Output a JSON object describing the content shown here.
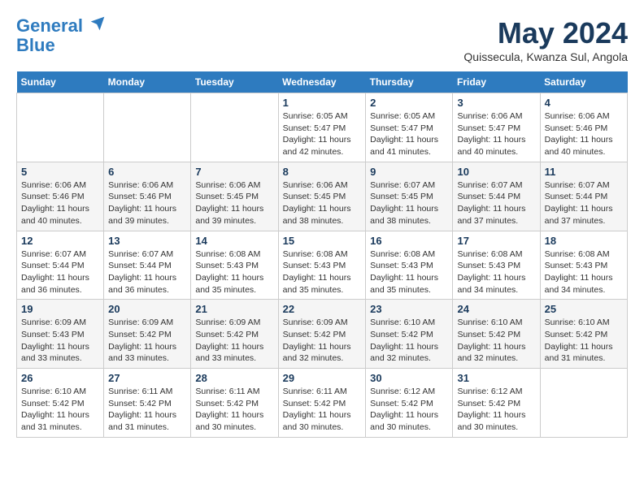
{
  "header": {
    "logo_line1": "General",
    "logo_line2": "Blue",
    "month_title": "May 2024",
    "location": "Quissecula, Kwanza Sul, Angola"
  },
  "weekdays": [
    "Sunday",
    "Monday",
    "Tuesday",
    "Wednesday",
    "Thursday",
    "Friday",
    "Saturday"
  ],
  "weeks": [
    [
      {
        "day": "",
        "info": ""
      },
      {
        "day": "",
        "info": ""
      },
      {
        "day": "",
        "info": ""
      },
      {
        "day": "1",
        "info": "Sunrise: 6:05 AM\nSunset: 5:47 PM\nDaylight: 11 hours and 42 minutes."
      },
      {
        "day": "2",
        "info": "Sunrise: 6:05 AM\nSunset: 5:47 PM\nDaylight: 11 hours and 41 minutes."
      },
      {
        "day": "3",
        "info": "Sunrise: 6:06 AM\nSunset: 5:47 PM\nDaylight: 11 hours and 40 minutes."
      },
      {
        "day": "4",
        "info": "Sunrise: 6:06 AM\nSunset: 5:46 PM\nDaylight: 11 hours and 40 minutes."
      }
    ],
    [
      {
        "day": "5",
        "info": "Sunrise: 6:06 AM\nSunset: 5:46 PM\nDaylight: 11 hours and 40 minutes."
      },
      {
        "day": "6",
        "info": "Sunrise: 6:06 AM\nSunset: 5:46 PM\nDaylight: 11 hours and 39 minutes."
      },
      {
        "day": "7",
        "info": "Sunrise: 6:06 AM\nSunset: 5:45 PM\nDaylight: 11 hours and 39 minutes."
      },
      {
        "day": "8",
        "info": "Sunrise: 6:06 AM\nSunset: 5:45 PM\nDaylight: 11 hours and 38 minutes."
      },
      {
        "day": "9",
        "info": "Sunrise: 6:07 AM\nSunset: 5:45 PM\nDaylight: 11 hours and 38 minutes."
      },
      {
        "day": "10",
        "info": "Sunrise: 6:07 AM\nSunset: 5:44 PM\nDaylight: 11 hours and 37 minutes."
      },
      {
        "day": "11",
        "info": "Sunrise: 6:07 AM\nSunset: 5:44 PM\nDaylight: 11 hours and 37 minutes."
      }
    ],
    [
      {
        "day": "12",
        "info": "Sunrise: 6:07 AM\nSunset: 5:44 PM\nDaylight: 11 hours and 36 minutes."
      },
      {
        "day": "13",
        "info": "Sunrise: 6:07 AM\nSunset: 5:44 PM\nDaylight: 11 hours and 36 minutes."
      },
      {
        "day": "14",
        "info": "Sunrise: 6:08 AM\nSunset: 5:43 PM\nDaylight: 11 hours and 35 minutes."
      },
      {
        "day": "15",
        "info": "Sunrise: 6:08 AM\nSunset: 5:43 PM\nDaylight: 11 hours and 35 minutes."
      },
      {
        "day": "16",
        "info": "Sunrise: 6:08 AM\nSunset: 5:43 PM\nDaylight: 11 hours and 35 minutes."
      },
      {
        "day": "17",
        "info": "Sunrise: 6:08 AM\nSunset: 5:43 PM\nDaylight: 11 hours and 34 minutes."
      },
      {
        "day": "18",
        "info": "Sunrise: 6:08 AM\nSunset: 5:43 PM\nDaylight: 11 hours and 34 minutes."
      }
    ],
    [
      {
        "day": "19",
        "info": "Sunrise: 6:09 AM\nSunset: 5:43 PM\nDaylight: 11 hours and 33 minutes."
      },
      {
        "day": "20",
        "info": "Sunrise: 6:09 AM\nSunset: 5:42 PM\nDaylight: 11 hours and 33 minutes."
      },
      {
        "day": "21",
        "info": "Sunrise: 6:09 AM\nSunset: 5:42 PM\nDaylight: 11 hours and 33 minutes."
      },
      {
        "day": "22",
        "info": "Sunrise: 6:09 AM\nSunset: 5:42 PM\nDaylight: 11 hours and 32 minutes."
      },
      {
        "day": "23",
        "info": "Sunrise: 6:10 AM\nSunset: 5:42 PM\nDaylight: 11 hours and 32 minutes."
      },
      {
        "day": "24",
        "info": "Sunrise: 6:10 AM\nSunset: 5:42 PM\nDaylight: 11 hours and 32 minutes."
      },
      {
        "day": "25",
        "info": "Sunrise: 6:10 AM\nSunset: 5:42 PM\nDaylight: 11 hours and 31 minutes."
      }
    ],
    [
      {
        "day": "26",
        "info": "Sunrise: 6:10 AM\nSunset: 5:42 PM\nDaylight: 11 hours and 31 minutes."
      },
      {
        "day": "27",
        "info": "Sunrise: 6:11 AM\nSunset: 5:42 PM\nDaylight: 11 hours and 31 minutes."
      },
      {
        "day": "28",
        "info": "Sunrise: 6:11 AM\nSunset: 5:42 PM\nDaylight: 11 hours and 30 minutes."
      },
      {
        "day": "29",
        "info": "Sunrise: 6:11 AM\nSunset: 5:42 PM\nDaylight: 11 hours and 30 minutes."
      },
      {
        "day": "30",
        "info": "Sunrise: 6:12 AM\nSunset: 5:42 PM\nDaylight: 11 hours and 30 minutes."
      },
      {
        "day": "31",
        "info": "Sunrise: 6:12 AM\nSunset: 5:42 PM\nDaylight: 11 hours and 30 minutes."
      },
      {
        "day": "",
        "info": ""
      }
    ]
  ]
}
